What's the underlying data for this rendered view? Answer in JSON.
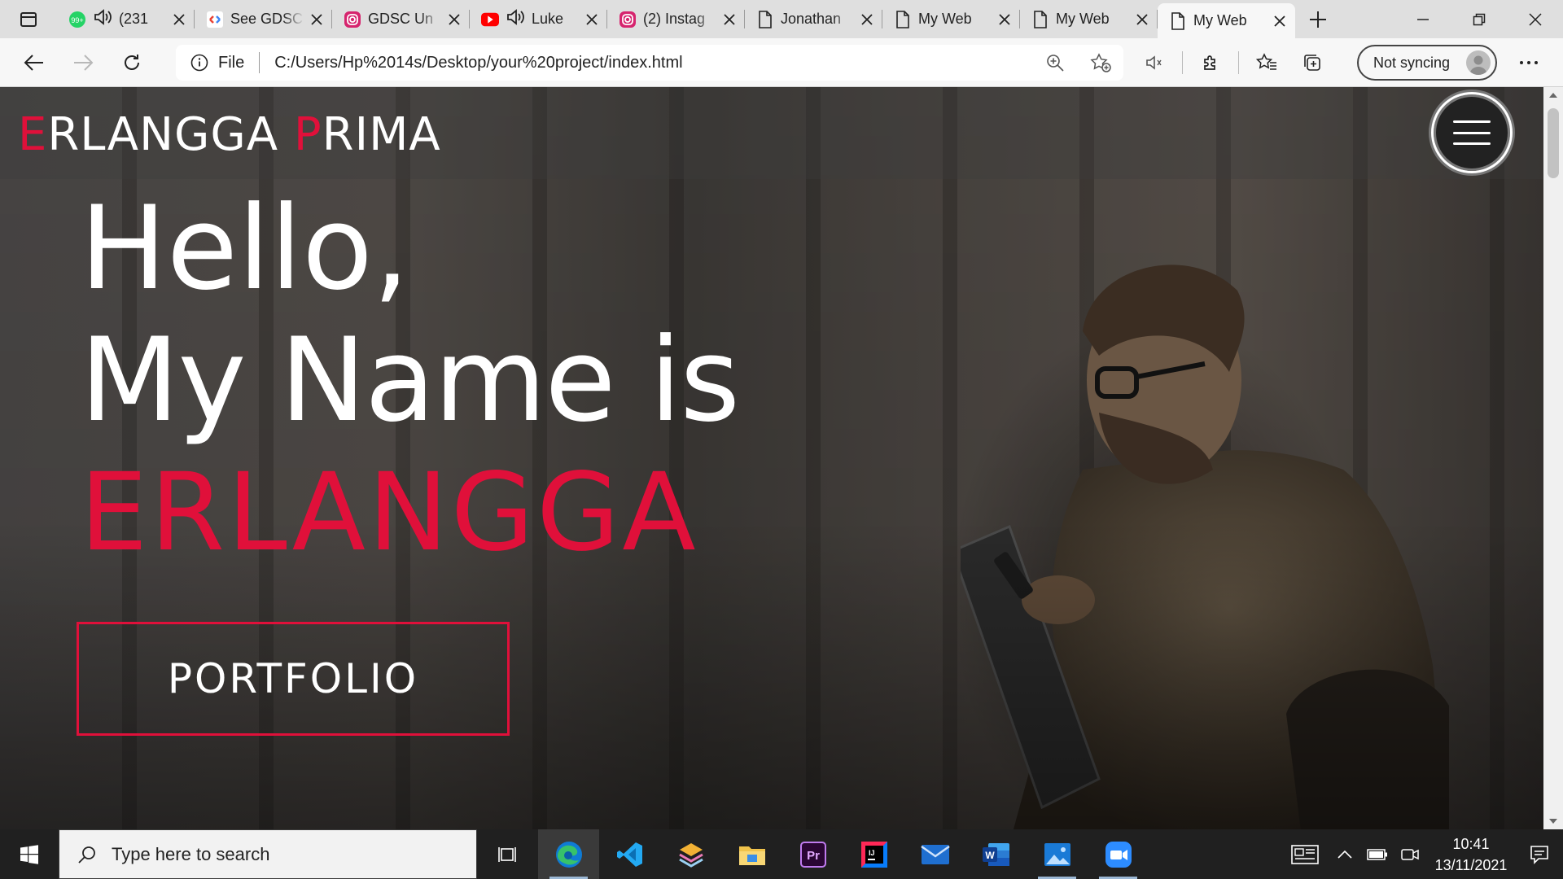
{
  "browser": {
    "tabs": [
      {
        "title": "(231",
        "favicon": "whatsapp-icon",
        "audio": true
      },
      {
        "title": "See GDSC",
        "favicon": "gdsc-icon",
        "audio": false
      },
      {
        "title": "GDSC Un",
        "favicon": "instagram-icon",
        "audio": false
      },
      {
        "title": "Luke",
        "favicon": "youtube-icon",
        "audio": true
      },
      {
        "title": "(2) Instag",
        "favicon": "instagram-icon",
        "audio": false
      },
      {
        "title": "Jonathan",
        "favicon": "page-icon",
        "audio": false
      },
      {
        "title": "My Web",
        "favicon": "page-icon",
        "audio": false
      },
      {
        "title": "My Web",
        "favicon": "page-icon",
        "audio": false
      },
      {
        "title": "My Web",
        "favicon": "page-icon",
        "audio": false,
        "active": true
      }
    ],
    "address": {
      "scheme_label": "File",
      "url": "C:/Users/Hp%2014s/Desktop/your%20project/index.html"
    },
    "sync_label": "Not syncing"
  },
  "page": {
    "brand": {
      "first_initial": "E",
      "first_rest": "RLANGGA ",
      "last_initial": "P",
      "last_rest": "RIMA"
    },
    "hero": {
      "line1": "Hello,",
      "line2": "My Name is",
      "name": "ERLANGGA"
    },
    "cta_label": "PORTFOLIO",
    "accent_color": "#e0103a"
  },
  "taskbar": {
    "search_placeholder": "Type here to search",
    "apps": [
      "task-view-icon",
      "edge-icon",
      "vscode-icon",
      "layers-app-icon",
      "file-explorer-icon",
      "premiere-icon",
      "intellij-icon",
      "mail-icon",
      "word-icon",
      "photos-icon",
      "zoom-icon"
    ],
    "time": "10:41",
    "date": "13/11/2021"
  }
}
